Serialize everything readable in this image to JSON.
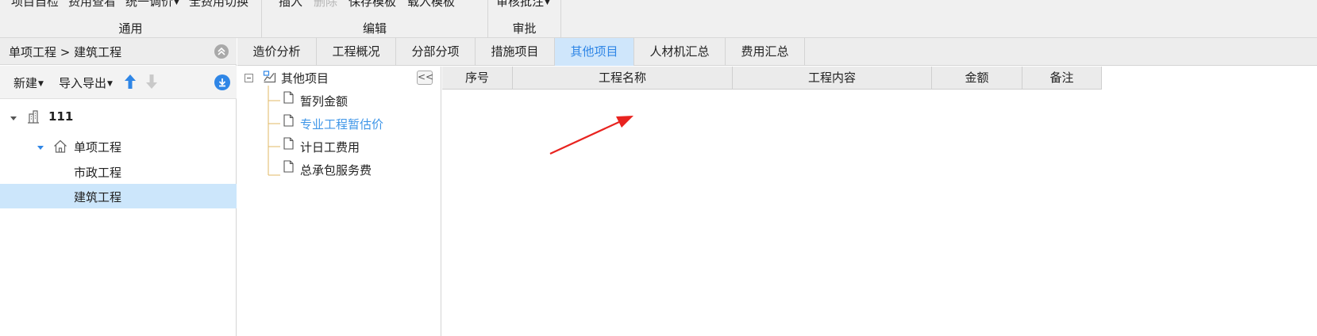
{
  "ribbon": {
    "groups": [
      {
        "label": "通用",
        "items": [
          "项目自检",
          "费用查看",
          "统一调价",
          "全费用切换"
        ]
      },
      {
        "label": "编辑",
        "items": [
          "插入",
          "删除",
          "保存模板",
          "载入模板"
        ]
      },
      {
        "label": "审批",
        "items": [
          "审核批注"
        ]
      }
    ]
  },
  "left_panel": {
    "breadcrumb": "单项工程 > 建筑工程",
    "toolbar": {
      "new_label": "新建",
      "import_export_label": "导入导出"
    },
    "tree": [
      {
        "label": "111"
      },
      {
        "label": "单项工程"
      },
      {
        "label": "市政工程"
      },
      {
        "label": "建筑工程"
      }
    ]
  },
  "tabs": [
    "造价分析",
    "工程概况",
    "分部分项",
    "措施项目",
    "其他项目",
    "人材机汇总",
    "费用汇总"
  ],
  "active_tab": "其他项目",
  "mid_tree": {
    "root": "其他项目",
    "children": [
      "暂列金额",
      "专业工程暂估价",
      "计日工费用",
      "总承包服务费"
    ],
    "selected_child": "专业工程暂估价",
    "collapse_label": "<<"
  },
  "grid": {
    "columns": [
      "序号",
      "工程名称",
      "工程内容",
      "金额",
      "备注"
    ],
    "rows": []
  },
  "colors": {
    "accent": "#2f86e6",
    "selected_bg": "#cce6fb",
    "annotation_arrow": "#e8231f"
  }
}
